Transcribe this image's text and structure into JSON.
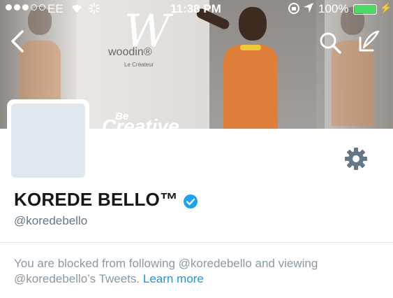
{
  "status_bar": {
    "carrier": "EE",
    "time": "11:38 PM",
    "battery_percent": "100%",
    "battery_level": 1.0,
    "signal_dots": [
      true,
      true,
      true,
      false,
      false
    ]
  },
  "banner": {
    "logo_letter": "W",
    "logo_name": "woodin®",
    "logo_sub": "Le Créateur",
    "slogan_top": "Be",
    "slogan_bottom": "Creative"
  },
  "profile": {
    "display_name": "KOREDE BELLO™",
    "handle": "@koredebello",
    "verified": true
  },
  "blocked_notice": {
    "text": "You are blocked from following @koredebello and viewing @koredebello’s Tweets.",
    "link_label": "Learn more"
  },
  "colors": {
    "link": "#1b95e0",
    "muted_text": "#8899a6",
    "verified_badge": "#1da1f2",
    "avatar_placeholder": "#e1e8ed"
  }
}
